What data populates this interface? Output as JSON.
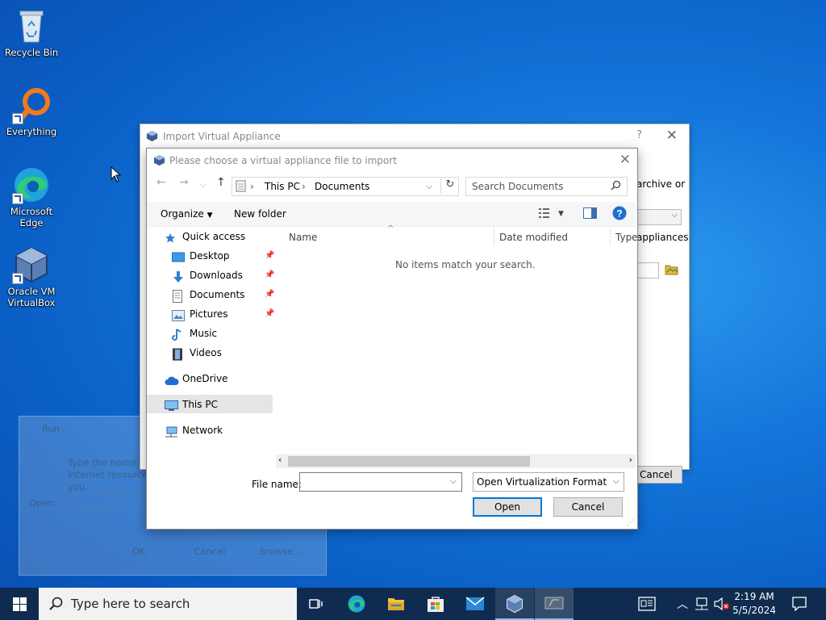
{
  "desktop": {
    "icons": [
      {
        "label": "Recycle Bin"
      },
      {
        "label": "Everything"
      },
      {
        "label": "Microsoft Edge"
      },
      {
        "label": "Oracle VM VirtualBox"
      }
    ]
  },
  "run_dialog": {
    "title": "Run",
    "description": "Type the name of a program, folder, document, or Internet resource, and Windows will open it for you.",
    "open_label": "Open:",
    "buttons": [
      "OK",
      "Cancel",
      "Browse..."
    ]
  },
  "import_window": {
    "title": "Import Virtual Appliance",
    "help": "?",
    "side_text_1": "archive or",
    "side_text_2": "appliances",
    "cancel_label": "Cancel"
  },
  "file_dialog": {
    "title": "Please choose a virtual appliance file to import",
    "breadcrumb": [
      "This PC",
      "Documents"
    ],
    "search_placeholder": "Search Documents",
    "organize_label": "Organize",
    "new_folder_label": "New folder",
    "columns": [
      "Name",
      "Date modified",
      "Type"
    ],
    "empty_message": "No items match your search.",
    "sidebar": [
      {
        "label": "Quick access",
        "icon": "star-icon",
        "pinned": false
      },
      {
        "label": "Desktop",
        "icon": "desktop-folder-icon",
        "pinned": true
      },
      {
        "label": "Downloads",
        "icon": "download-arrow-icon",
        "pinned": true
      },
      {
        "label": "Documents",
        "icon": "document-icon",
        "pinned": true
      },
      {
        "label": "Pictures",
        "icon": "pictures-icon",
        "pinned": true
      },
      {
        "label": "Music",
        "icon": "music-note-icon",
        "pinned": false
      },
      {
        "label": "Videos",
        "icon": "film-icon",
        "pinned": false
      },
      {
        "label": "OneDrive",
        "icon": "cloud-icon",
        "pinned": false
      },
      {
        "label": "This PC",
        "icon": "monitor-icon",
        "pinned": false,
        "selected": true
      },
      {
        "label": "Network",
        "icon": "network-icon",
        "pinned": false
      }
    ],
    "filename_label": "File name:",
    "filename_value": "",
    "filetype_value": "Open Virtualization Format (*.o",
    "open_label": "Open",
    "cancel_label": "Cancel"
  },
  "taskbar": {
    "search_placeholder": "Type here to search",
    "time": "2:19 AM",
    "date": "5/5/2024"
  },
  "colors": {
    "desktop_blue": "#0a5fc6",
    "taskbar": "#0f2c50",
    "accent": "#0078d7"
  }
}
